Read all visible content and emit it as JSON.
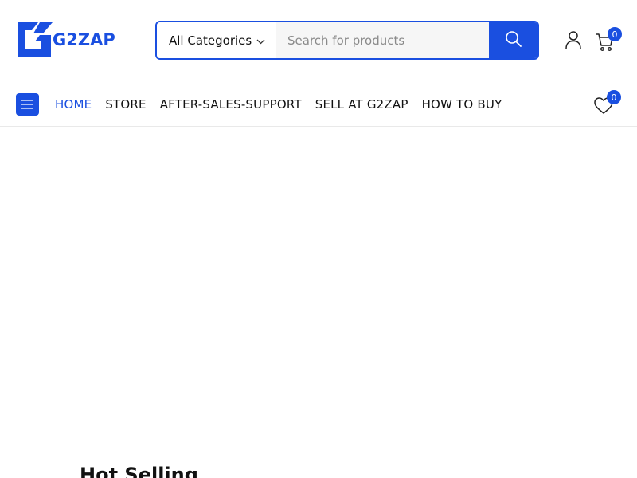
{
  "brand": {
    "logo_text": "G2ZAP",
    "accent_color": "#1a4fe0"
  },
  "search": {
    "category_label": "All Categories",
    "placeholder": "Search for products",
    "value": ""
  },
  "header": {
    "cart_count": "0",
    "wishlist_count": "0"
  },
  "nav": {
    "items": [
      {
        "label": "HOME",
        "active": true
      },
      {
        "label": "STORE"
      },
      {
        "label": "AFTER-SALES-SUPPORT"
      },
      {
        "label": "SELL AT G2ZAP"
      },
      {
        "label": "HOW TO BUY"
      }
    ]
  },
  "icons": {
    "logo": "g2zap-logo-mark",
    "category_dropdown": "chevron-down-icon",
    "search": "search-icon",
    "account": "user-icon",
    "cart": "cart-icon",
    "menu": "hamburger-menu-icon",
    "wishlist": "heart-icon"
  },
  "sections": {
    "hot_selling_title": "Hot Selling"
  }
}
